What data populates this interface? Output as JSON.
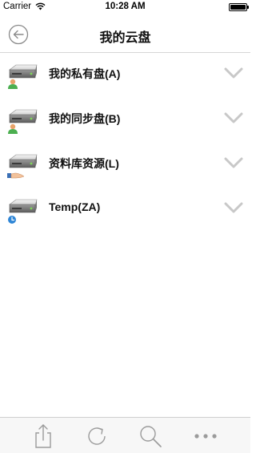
{
  "status_bar": {
    "carrier": "Carrier",
    "time": "10:28 AM"
  },
  "nav": {
    "title": "我的云盘",
    "back_icon": "back-arrow-circle-icon"
  },
  "drives": [
    {
      "label": "我的私有盘(A)",
      "icon": "drive-user-icon"
    },
    {
      "label": "我的同步盘(B)",
      "icon": "drive-user-icon"
    },
    {
      "label": "资料库资源(L)",
      "icon": "drive-shared-hand-icon"
    },
    {
      "label": "Temp(ZA)",
      "icon": "drive-clock-icon"
    }
  ],
  "toolbar": {
    "items": [
      "share-icon",
      "refresh-icon",
      "search-icon",
      "more-icon"
    ]
  },
  "colors": {
    "accent": "#4a90d9",
    "icon_gray": "#9b9b9b",
    "chevron": "#c8c8c8"
  }
}
